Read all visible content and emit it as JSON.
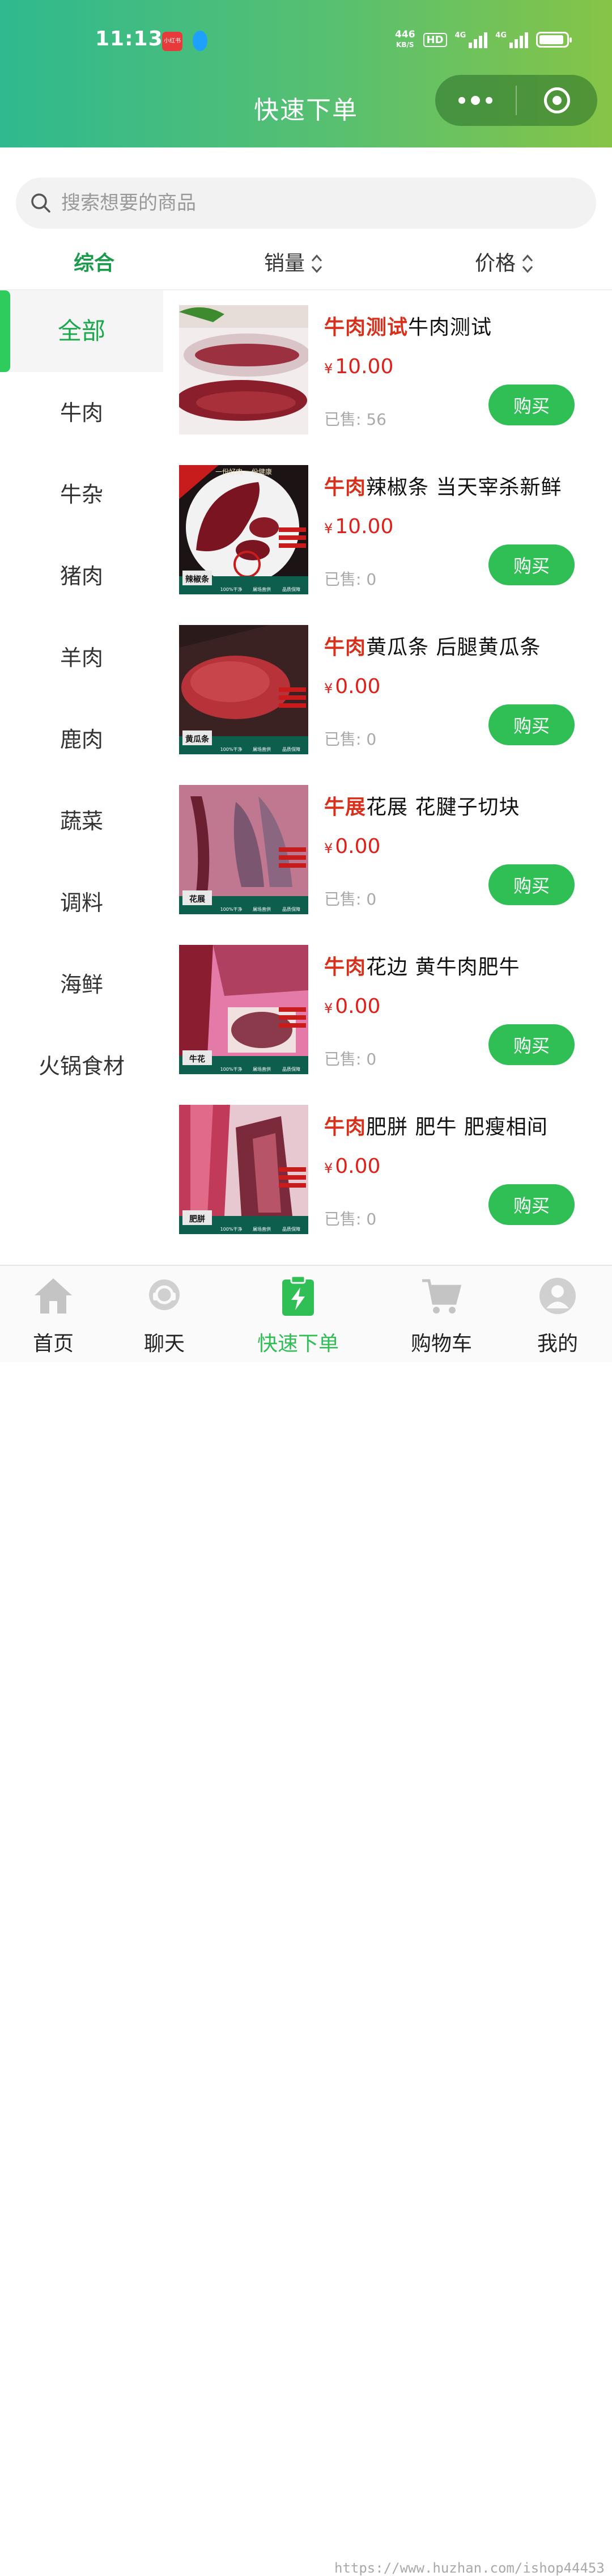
{
  "status_bar": {
    "time": "11:13",
    "app_badge": "小红书",
    "net_speed_value": "446",
    "net_speed_unit": "KB/S",
    "hd": "HD",
    "signal1_label": "4G",
    "signal2_label": "4G"
  },
  "header": {
    "title": "快速下单"
  },
  "search": {
    "placeholder": "搜索想要的商品"
  },
  "sort_bar": {
    "composite": "综合",
    "sales": "销量",
    "price": "价格"
  },
  "categories": [
    {
      "label": "全部",
      "active": true
    },
    {
      "label": "牛肉"
    },
    {
      "label": "牛杂"
    },
    {
      "label": "猪肉"
    },
    {
      "label": "羊肉"
    },
    {
      "label": "鹿肉"
    },
    {
      "label": "蔬菜"
    },
    {
      "label": "调料"
    },
    {
      "label": "海鲜"
    },
    {
      "label": "火锅食材"
    }
  ],
  "products": [
    {
      "tag": "牛肉测试",
      "name": "牛肉测试",
      "currency": "¥",
      "price": "10.00",
      "sold": "已售: 56",
      "buy": "购买",
      "image_caption": ""
    },
    {
      "tag": "牛肉",
      "name": "辣椒条 当天宰杀新鲜",
      "currency": "¥",
      "price": "10.00",
      "sold": "已售: 0",
      "buy": "购买",
      "image_caption": "辣椒条",
      "image_banner": "一份好肉 一份健康"
    },
    {
      "tag": "牛肉",
      "name": "黄瓜条 后腿黄瓜条",
      "currency": "¥",
      "price": "0.00",
      "sold": "已售: 0",
      "buy": "购买",
      "image_caption": "黄瓜条"
    },
    {
      "tag": "牛展",
      "name": "花展 花腱子切块",
      "currency": "¥",
      "price": "0.00",
      "sold": "已售: 0",
      "buy": "购买",
      "image_caption": "花展"
    },
    {
      "tag": "牛肉",
      "name": "花边 黄牛肉肥牛",
      "currency": "¥",
      "price": "0.00",
      "sold": "已售: 0",
      "buy": "购买",
      "image_caption": "牛花"
    },
    {
      "tag": "牛肉",
      "name": "肥胼 肥牛 肥瘦相间",
      "currency": "¥",
      "price": "0.00",
      "sold": "已售: 0",
      "buy": "购买",
      "image_caption": "肥胼"
    }
  ],
  "image_footer": [
    "100%干净",
    "屠场直供",
    "品质保障"
  ],
  "tab_bar": [
    {
      "label": "首页",
      "icon": "home-icon"
    },
    {
      "label": "聊天",
      "icon": "chat-icon"
    },
    {
      "label": "快速下单",
      "icon": "quick-order-icon",
      "active": true
    },
    {
      "label": "购物车",
      "icon": "cart-icon"
    },
    {
      "label": "我的",
      "icon": "profile-icon"
    }
  ],
  "watermark": "https://www.huzhan.com/ishop44453",
  "colors": {
    "accent": "#2fbf55",
    "price": "#e0201a",
    "tag": "#d8301b",
    "header_start": "#2fb98f",
    "header_end": "#86c447"
  }
}
